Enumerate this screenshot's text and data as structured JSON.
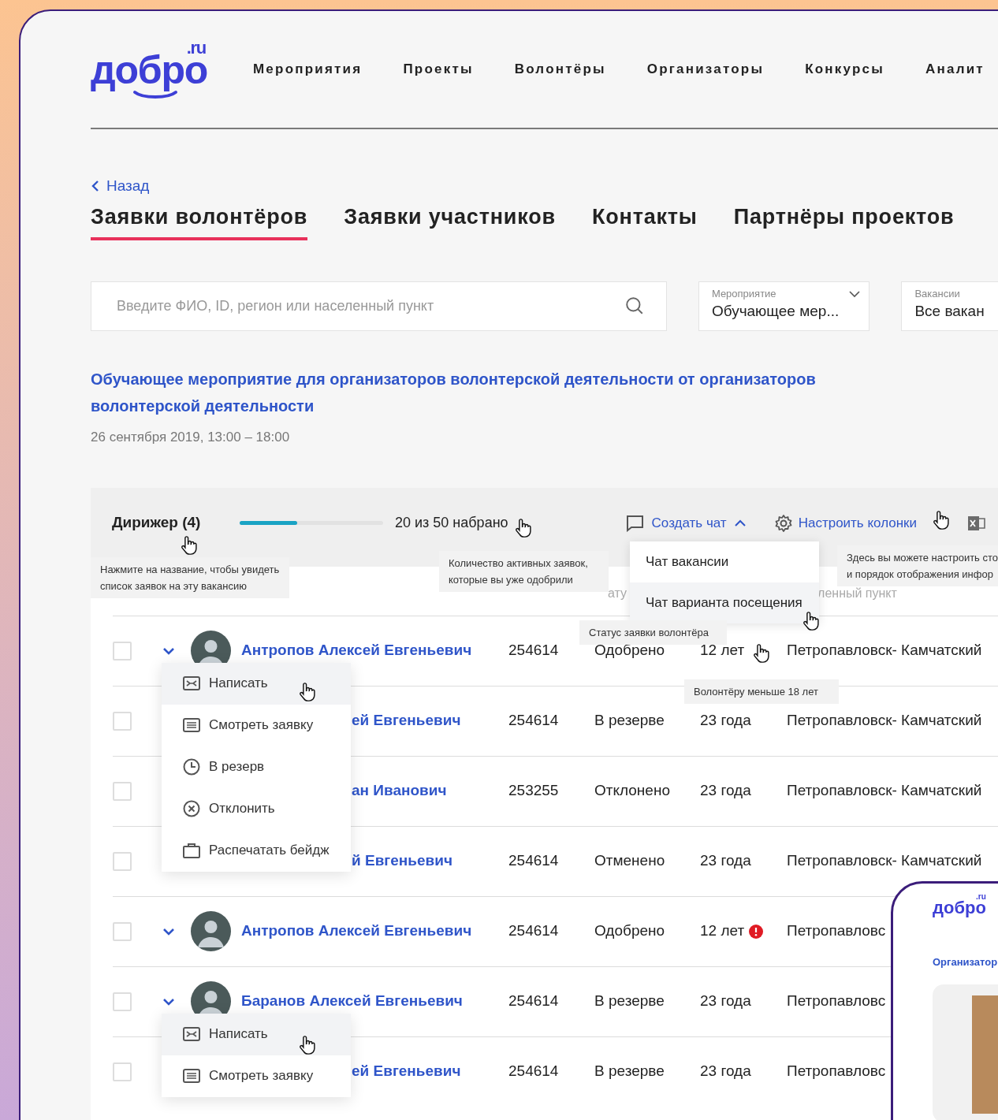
{
  "logo": {
    "text": "добро",
    "suffix": ".ru"
  },
  "nav": [
    "Мероприятия",
    "Проекты",
    "Волонтёры",
    "Организаторы",
    "Конкурсы",
    "Аналит"
  ],
  "back_link": "Назад",
  "tabs": [
    {
      "label": "Заявки волонтёров",
      "selected": true
    },
    {
      "label": "Заявки участников",
      "selected": false
    },
    {
      "label": "Контакты",
      "selected": false
    },
    {
      "label": "Партнёры проектов",
      "selected": false
    }
  ],
  "search": {
    "placeholder": "Введите ФИО, ID, регион или населенный пункт"
  },
  "filters": [
    {
      "label": "Мероприятие",
      "value": "Обучающее мер..."
    },
    {
      "label": "Вакансии",
      "value": "Все вакан"
    }
  ],
  "event": {
    "title": "Обучающее мероприятие для организаторов волонтерской деятельности от организаторов волонтерской деятельности",
    "date": "26 сентября 2019, 13:00 – 18:00"
  },
  "vacancy_bar": {
    "name": "Дирижер (4)",
    "level": 0.4,
    "count": "20 из 50 набрано",
    "create_chat": "Создать чат",
    "configure_columns": "Настроить колонки"
  },
  "chat_menu": [
    {
      "label": "Чат вакансии",
      "selected": false
    },
    {
      "label": "Чат варианта посещения",
      "selected": true
    }
  ],
  "table": {
    "header": {
      "column_1": "ату",
      "column_2": "ленный пункт"
    },
    "rows": [
      {
        "checked": false,
        "avatar": true,
        "name": "Антропов Алексей Евгеньевич",
        "id": "254614",
        "status": "Одобрено",
        "age": "12 лет",
        "alert": false,
        "city": "Петропавловск- Камчатский",
        "menu": [
          {
            "kind": "mail",
            "label": "Написать",
            "selected": true
          },
          {
            "kind": "document",
            "label": "Смотреть заявку",
            "selected": false
          },
          {
            "kind": "clock",
            "label": "В резерв",
            "selected": false
          },
          {
            "kind": "cancel",
            "label": "Отклонить",
            "selected": false
          },
          {
            "kind": "badge",
            "label": "Распечатать бейдж",
            "selected": false
          }
        ]
      },
      {
        "checked": false,
        "avatar": false,
        "name": "ей Евгеньевич",
        "id": "254614",
        "status": "В резерве",
        "age": "23 года",
        "alert": false,
        "city": "Петропавловск- Камчатский"
      },
      {
        "checked": false,
        "avatar": false,
        "name": "ан Иванович",
        "id": "253255",
        "status": "Отклонено",
        "age": "23 года",
        "alert": false,
        "city": "Петропавловск- Камчатский"
      },
      {
        "checked": false,
        "avatar": false,
        "name": "й Евгеньевич",
        "id": "254614",
        "status": "Отменено",
        "age": "23 года",
        "alert": false,
        "city": "Петропавловск- Камчатский"
      },
      {
        "checked": false,
        "avatar": true,
        "name": "Антропов Алексей Евгеньевич",
        "id": "254614",
        "status": "Одобрено",
        "age": "12 лет",
        "alert": true,
        "city": "Петропавловс"
      },
      {
        "checked": false,
        "avatar": true,
        "name": "Баранов Алексей Евгеньевич",
        "id": "254614",
        "status": "В резерве",
        "age": "23 года",
        "alert": false,
        "city": "Петропавловс",
        "menu": [
          {
            "kind": "mail",
            "label": "Написать",
            "selected": true
          },
          {
            "kind": "document",
            "label": "Смотреть заявку",
            "selected": false
          }
        ]
      },
      {
        "checked": false,
        "avatar": false,
        "name": "ей Евгеньевич",
        "id": "254614",
        "status": "В резерве",
        "age": "23 года",
        "alert": false,
        "city": "Петропавловс"
      }
    ]
  },
  "tooltips": [
    "Нажмите на название, чтобы увидеть\nсписок заявок на эту вакансию",
    "Количество активных заявок,\nкоторые вы уже одобрили",
    "Статус заявки волонтёра",
    "Волонтёру меньше 18 лет",
    "Здесь вы можете настроить сто\nи порядок отображения инфор"
  ],
  "inset": {
    "logo": "добро",
    "suffix": ".ru",
    "heading": "Организатор"
  }
}
